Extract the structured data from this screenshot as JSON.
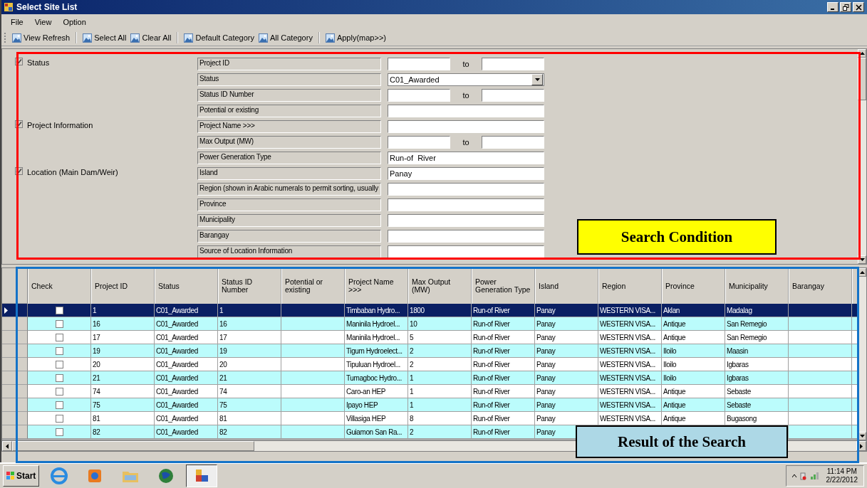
{
  "window": {
    "title": "Select Site List"
  },
  "menu": [
    "File",
    "View",
    "Option"
  ],
  "toolbar": [
    {
      "label": "View Refresh",
      "sep_before": false
    },
    {
      "label": "Select All",
      "sep_before": true
    },
    {
      "label": "Clear All",
      "sep_before": false
    },
    {
      "label": "Default Category",
      "sep_before": true
    },
    {
      "label": "All Category",
      "sep_before": false
    },
    {
      "label": "Apply(map>>)",
      "sep_before": true
    }
  ],
  "search": {
    "fields": [
      {
        "label": "Project ID",
        "kind": "range",
        "to_label": "to",
        "group": {
          "label": "Status",
          "checked": true
        }
      },
      {
        "label": "Status",
        "kind": "dropdown",
        "value": "C01_Awarded"
      },
      {
        "label": "Status ID Number",
        "kind": "range",
        "to_label": "to"
      },
      {
        "label": "Potential or existing",
        "kind": "text"
      },
      {
        "label": "Project Name >>>",
        "kind": "text",
        "group": {
          "label": "Project Information",
          "checked": true
        }
      },
      {
        "label": "Max Output (MW)",
        "kind": "range",
        "to_label": "to"
      },
      {
        "label": "Power Generation Type",
        "kind": "text",
        "value": "Run-of  River"
      },
      {
        "label": "Island",
        "kind": "text",
        "value": "Panay",
        "group": {
          "label": "Location (Main Dam/Weir)",
          "checked": true
        }
      },
      {
        "label": "Region (shown in Arabic numerals to permit sorting, usually",
        "kind": "text"
      },
      {
        "label": "Province",
        "kind": "text"
      },
      {
        "label": "Municipality",
        "kind": "text"
      },
      {
        "label": "Barangay",
        "kind": "text"
      },
      {
        "label": "Source of Location Information",
        "kind": "text"
      }
    ]
  },
  "grid": {
    "check_column": "Check",
    "columns": [
      "Project ID",
      "Status",
      "Status ID Number",
      "Potential or existing",
      "Project Name >>>",
      "Max Output (MW)",
      "Power Generation Type",
      "Island",
      "Region",
      "Province",
      "Municipality",
      "Barangay"
    ],
    "rows": [
      {
        "selected": true,
        "checked": false,
        "cells": [
          "1",
          "C01_Awarded",
          "1",
          "",
          "Timbaban Hydro...",
          "1800",
          "Run-of  River",
          "Panay",
          "WESTERN VISA...",
          "Aklan",
          "Madalag",
          ""
        ]
      },
      {
        "selected": false,
        "checked": false,
        "cells": [
          "16",
          "C01_Awarded",
          "16",
          "",
          "Maninila Hydroel...",
          "10",
          "Run-of  River",
          "Panay",
          "WESTERN VISA...",
          "Antique",
          "San Remegio",
          ""
        ]
      },
      {
        "selected": false,
        "checked": false,
        "cells": [
          "17",
          "C01_Awarded",
          "17",
          "",
          "Maninila Hydroel...",
          "5",
          "Run-of  River",
          "Panay",
          "WESTERN VISA...",
          "Antique",
          "San Remegio",
          ""
        ]
      },
      {
        "selected": false,
        "checked": false,
        "cells": [
          "19",
          "C01_Awarded",
          "19",
          "",
          "Tigum Hydroelect...",
          "2",
          "Run-of  River",
          "Panay",
          "WESTERN VISA...",
          "Iloilo",
          "Maasin",
          ""
        ]
      },
      {
        "selected": false,
        "checked": false,
        "cells": [
          "20",
          "C01_Awarded",
          "20",
          "",
          "Tipuluan Hydroel...",
          "2",
          "Run-of  River",
          "Panay",
          "WESTERN VISA...",
          "Iloilo",
          "Igbaras",
          ""
        ]
      },
      {
        "selected": false,
        "checked": false,
        "cells": [
          "21",
          "C01_Awarded",
          "21",
          "",
          "Tumagboc Hydro...",
          "1",
          "Run-of  River",
          "Panay",
          "WESTERN VISA...",
          "Iloilo",
          "Igbaras",
          ""
        ]
      },
      {
        "selected": false,
        "checked": false,
        "cells": [
          "74",
          "C01_Awarded",
          "74",
          "",
          "Caro-an HEP",
          "1",
          "Run-of  River",
          "Panay",
          "WESTERN VISA...",
          "Antique",
          "Sebaste",
          ""
        ]
      },
      {
        "selected": false,
        "checked": false,
        "cells": [
          "75",
          "C01_Awarded",
          "75",
          "",
          "Ipayo HEP",
          "1",
          "Run-of  River",
          "Panay",
          "WESTERN VISA...",
          "Antique",
          "Sebaste",
          ""
        ]
      },
      {
        "selected": false,
        "checked": false,
        "cells": [
          "81",
          "C01_Awarded",
          "81",
          "",
          "Villasiga HEP",
          "8",
          "Run-of  River",
          "Panay",
          "WESTERN VISA...",
          "Antique",
          "Bugasong",
          ""
        ]
      },
      {
        "selected": false,
        "checked": false,
        "cells": [
          "82",
          "C01_Awarded",
          "82",
          "",
          "Guiamon San Ra...",
          "2",
          "Run-of  River",
          "Panay",
          null,
          null,
          null,
          ""
        ]
      }
    ]
  },
  "taskbar": {
    "start": "Start",
    "time": "11:14 PM",
    "date": "2/22/2012"
  },
  "annotations": [
    {
      "kind": "search",
      "text": "Search Condition"
    },
    {
      "kind": "result",
      "text": "Result of the Search"
    }
  ]
}
